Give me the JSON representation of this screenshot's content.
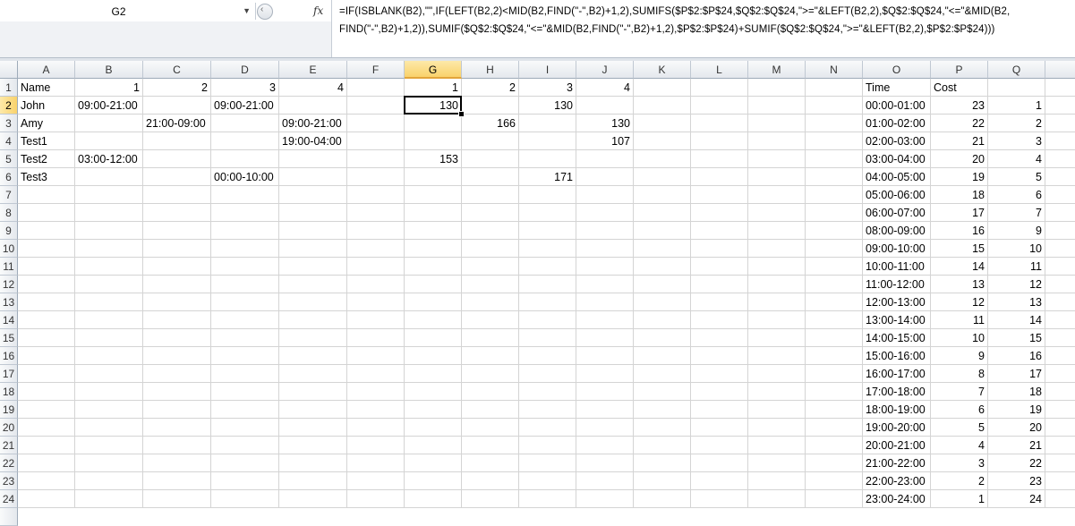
{
  "name_box": {
    "value": "G2"
  },
  "formula_bar": {
    "fx_label": "fx",
    "line1": "=IF(ISBLANK(B2),\"\",IF(LEFT(B2,2)<MID(B2,FIND(\"-\",B2)+1,2),SUMIFS($P$2:$P$24,$Q$2:$Q$24,\">=\"&LEFT(B2,2),$Q$2:$Q$24,\"<=\"&MID(B2,",
    "line2": "FIND(\"-\",B2)+1,2)),SUMIF($Q$2:$Q$24,\"<=\"&MID(B2,FIND(\"-\",B2)+1,2),$P$2:$P$24)+SUMIF($Q$2:$Q$24,\">=\"&LEFT(B2,2),$P$2:$P$24)))"
  },
  "columns": [
    "A",
    "B",
    "C",
    "D",
    "E",
    "F",
    "G",
    "H",
    "I",
    "J",
    "K",
    "L",
    "M",
    "N",
    "O",
    "P",
    "Q"
  ],
  "selected_column": "G",
  "selected_row": 2,
  "rows": [
    [
      "Name",
      "1",
      "2",
      "3",
      "4",
      "",
      "1",
      "2",
      "3",
      "4",
      "",
      "",
      "",
      "",
      "Time",
      "Cost",
      ""
    ],
    [
      "John",
      "09:00-21:00",
      "",
      "09:00-21:00",
      "",
      "",
      "130",
      "",
      "130",
      "",
      "",
      "",
      "",
      "",
      "00:00-01:00",
      "23",
      "1"
    ],
    [
      "Amy",
      "",
      "21:00-09:00",
      "",
      "09:00-21:00",
      "",
      "",
      "166",
      "",
      "130",
      "",
      "",
      "",
      "",
      "01:00-02:00",
      "22",
      "2"
    ],
    [
      "Test1",
      "",
      "",
      "",
      "19:00-04:00",
      "",
      "",
      "",
      "",
      "107",
      "",
      "",
      "",
      "",
      "02:00-03:00",
      "21",
      "3"
    ],
    [
      "Test2",
      "03:00-12:00",
      "",
      "",
      "",
      "",
      "153",
      "",
      "",
      "",
      "",
      "",
      "",
      "",
      "03:00-04:00",
      "20",
      "4"
    ],
    [
      "Test3",
      "",
      "",
      "00:00-10:00",
      "",
      "",
      "",
      "",
      "171",
      "",
      "",
      "",
      "",
      "",
      "04:00-05:00",
      "19",
      "5"
    ],
    [
      "",
      "",
      "",
      "",
      "",
      "",
      "",
      "",
      "",
      "",
      "",
      "",
      "",
      "",
      "05:00-06:00",
      "18",
      "6"
    ],
    [
      "",
      "",
      "",
      "",
      "",
      "",
      "",
      "",
      "",
      "",
      "",
      "",
      "",
      "",
      "06:00-07:00",
      "17",
      "7"
    ],
    [
      "",
      "",
      "",
      "",
      "",
      "",
      "",
      "",
      "",
      "",
      "",
      "",
      "",
      "",
      "08:00-09:00",
      "16",
      "9"
    ],
    [
      "",
      "",
      "",
      "",
      "",
      "",
      "",
      "",
      "",
      "",
      "",
      "",
      "",
      "",
      "09:00-10:00",
      "15",
      "10"
    ],
    [
      "",
      "",
      "",
      "",
      "",
      "",
      "",
      "",
      "",
      "",
      "",
      "",
      "",
      "",
      "10:00-11:00",
      "14",
      "11"
    ],
    [
      "",
      "",
      "",
      "",
      "",
      "",
      "",
      "",
      "",
      "",
      "",
      "",
      "",
      "",
      "11:00-12:00",
      "13",
      "12"
    ],
    [
      "",
      "",
      "",
      "",
      "",
      "",
      "",
      "",
      "",
      "",
      "",
      "",
      "",
      "",
      "12:00-13:00",
      "12",
      "13"
    ],
    [
      "",
      "",
      "",
      "",
      "",
      "",
      "",
      "",
      "",
      "",
      "",
      "",
      "",
      "",
      "13:00-14:00",
      "11",
      "14"
    ],
    [
      "",
      "",
      "",
      "",
      "",
      "",
      "",
      "",
      "",
      "",
      "",
      "",
      "",
      "",
      "14:00-15:00",
      "10",
      "15"
    ],
    [
      "",
      "",
      "",
      "",
      "",
      "",
      "",
      "",
      "",
      "",
      "",
      "",
      "",
      "",
      "15:00-16:00",
      "9",
      "16"
    ],
    [
      "",
      "",
      "",
      "",
      "",
      "",
      "",
      "",
      "",
      "",
      "",
      "",
      "",
      "",
      "16:00-17:00",
      "8",
      "17"
    ],
    [
      "",
      "",
      "",
      "",
      "",
      "",
      "",
      "",
      "",
      "",
      "",
      "",
      "",
      "",
      "17:00-18:00",
      "7",
      "18"
    ],
    [
      "",
      "",
      "",
      "",
      "",
      "",
      "",
      "",
      "",
      "",
      "",
      "",
      "",
      "",
      "18:00-19:00",
      "6",
      "19"
    ],
    [
      "",
      "",
      "",
      "",
      "",
      "",
      "",
      "",
      "",
      "",
      "",
      "",
      "",
      "",
      "19:00-20:00",
      "5",
      "20"
    ],
    [
      "",
      "",
      "",
      "",
      "",
      "",
      "",
      "",
      "",
      "",
      "",
      "",
      "",
      "",
      "20:00-21:00",
      "4",
      "21"
    ],
    [
      "",
      "",
      "",
      "",
      "",
      "",
      "",
      "",
      "",
      "",
      "",
      "",
      "",
      "",
      "21:00-22:00",
      "3",
      "22"
    ],
    [
      "",
      "",
      "",
      "",
      "",
      "",
      "",
      "",
      "",
      "",
      "",
      "",
      "",
      "",
      "22:00-23:00",
      "2",
      "23"
    ],
    [
      "",
      "",
      "",
      "",
      "",
      "",
      "",
      "",
      "",
      "",
      "",
      "",
      "",
      "",
      "23:00-24:00",
      "1",
      "24"
    ]
  ]
}
